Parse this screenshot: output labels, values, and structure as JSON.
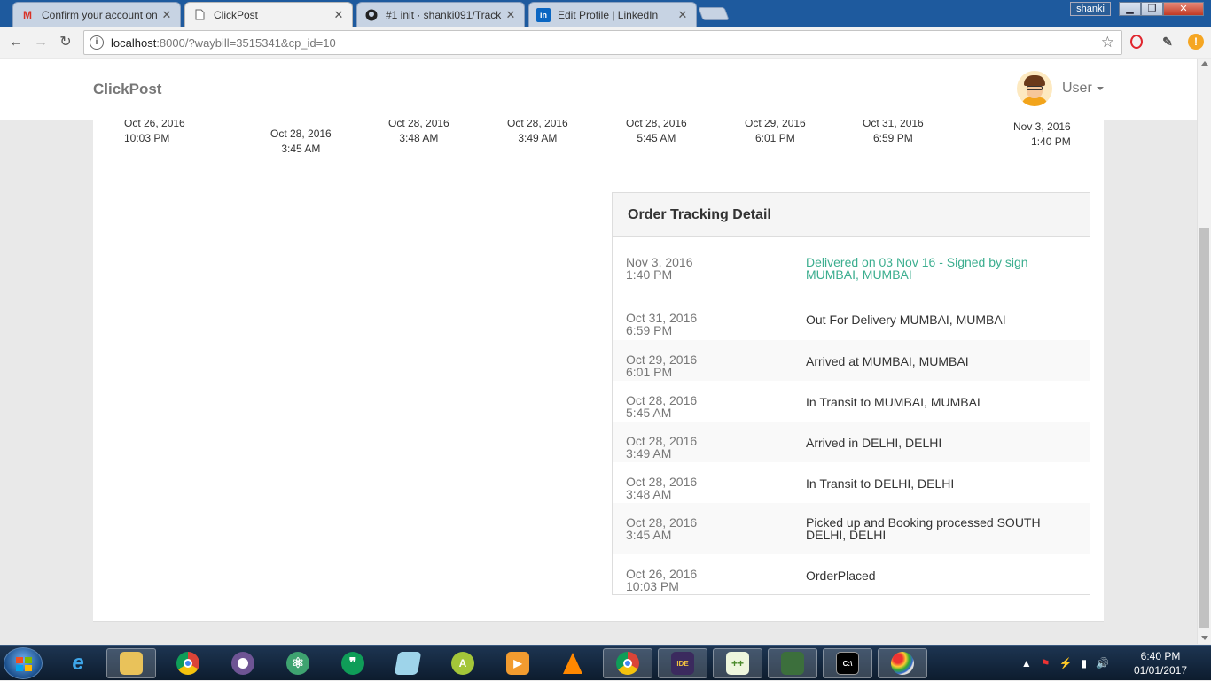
{
  "browser": {
    "tabs": [
      {
        "title": "Confirm your account on",
        "icon": "gmail-icon",
        "active": false
      },
      {
        "title": "ClickPost",
        "icon": "page-icon",
        "active": true
      },
      {
        "title": "#1 init · shanki091/Track",
        "icon": "github-icon",
        "active": false
      },
      {
        "title": "Edit Profile | LinkedIn",
        "icon": "linkedin-icon",
        "active": false
      }
    ],
    "profile_name": "shanki",
    "url_host": "localhost",
    "url_rest": ":8000/?waybill=3515341&cp_id=10"
  },
  "header": {
    "brand": "ClickPost",
    "user_name": "User"
  },
  "timeline": [
    {
      "date": "Oct 26, 2016",
      "time": "10:03 PM"
    },
    {
      "date": "Oct 28, 2016",
      "time": "3:45 AM"
    },
    {
      "date": "Oct 28, 2016",
      "time": "3:48 AM"
    },
    {
      "date": "Oct 28, 2016",
      "time": "3:49 AM"
    },
    {
      "date": "Oct 28, 2016",
      "time": "5:45 AM"
    },
    {
      "date": "Oct 29, 2016",
      "time": "6:01 PM"
    },
    {
      "date": "Oct 31, 2016",
      "time": "6:59 PM"
    },
    {
      "date": "Nov 3, 2016",
      "time": "1:40 PM"
    }
  ],
  "tracking": {
    "heading": "Order Tracking Detail",
    "rows": [
      {
        "date": "Nov 3, 2016",
        "time": "1:40 PM",
        "status": "Delivered on 03 Nov 16 - Signed by sign MUMBAI, MUMBAI"
      },
      {
        "date": "Oct 31, 2016",
        "time": "6:59 PM",
        "status": "Out For Delivery MUMBAI, MUMBAI"
      },
      {
        "date": "Oct 29, 2016",
        "time": "6:01 PM",
        "status": "Arrived at MUMBAI, MUMBAI"
      },
      {
        "date": "Oct 28, 2016",
        "time": "5:45 AM",
        "status": "In Transit to MUMBAI, MUMBAI"
      },
      {
        "date": "Oct 28, 2016",
        "time": "3:49 AM",
        "status": "Arrived in DELHI, DELHI"
      },
      {
        "date": "Oct 28, 2016",
        "time": "3:48 AM",
        "status": "In Transit to DELHI, DELHI"
      },
      {
        "date": "Oct 28, 2016",
        "time": "3:45 AM",
        "status": "Picked up and Booking processed SOUTH DELHI, DELHI"
      },
      {
        "date": "Oct 26, 2016",
        "time": "10:03 PM",
        "status": "OrderPlaced"
      }
    ]
  },
  "taskbar": {
    "time": "6:40 PM",
    "date": "01/01/2017",
    "apps": [
      "explorer",
      "chrome",
      "github-desktop",
      "atom",
      "hangouts",
      "notepad",
      "android-studio",
      "media-player",
      "vlc",
      "chrome",
      "java-ee-ide",
      "notepad-plus-plus",
      "task-manager",
      "cmd",
      "paint"
    ]
  },
  "colors": {
    "delivered": "#3cae8f",
    "brand_text": "#777777"
  }
}
